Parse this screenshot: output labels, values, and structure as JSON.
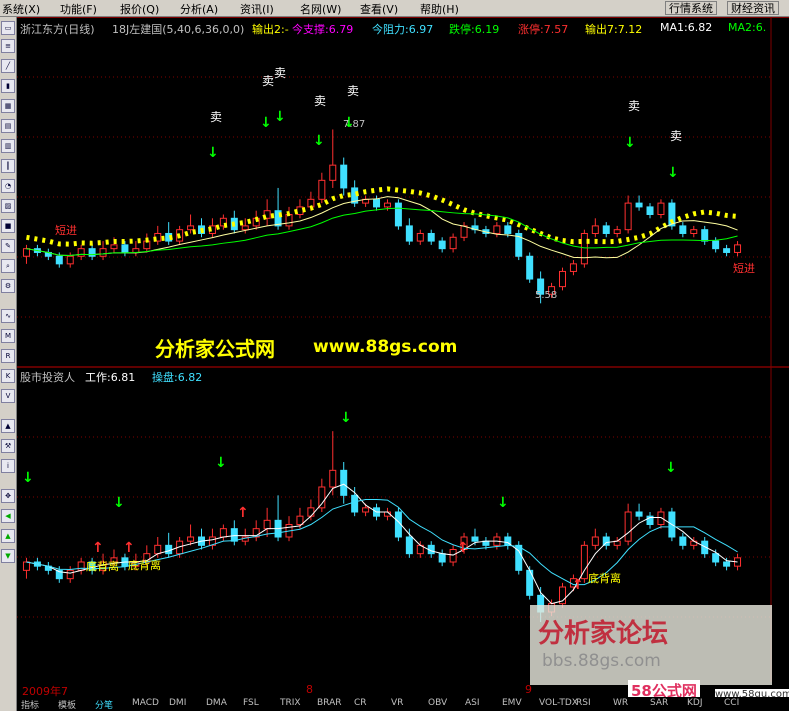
{
  "menu": {
    "items": [
      "系统(X)",
      "功能(F)",
      "报价(Q)",
      "分析(A)",
      "资讯(I)",
      "名网(W)",
      "查看(V)",
      "帮助(H)"
    ],
    "right_buttons": [
      "行情系统",
      "财经资讯"
    ]
  },
  "upper_panel": {
    "title": "浙江东方(日线)",
    "indicator": "18J左建国(5,40,6,36,0,0)",
    "out2": "输出2:-",
    "support": "今支撑:6.79",
    "resistance": "今阻力:6.97",
    "fall_stop": "跌停:6.19",
    "rise_stop": "涨停:7.57",
    "out3": "输出7:7.12",
    "ma1": "MA1:6.82",
    "ma2": "MA2:6.",
    "sell": "卖",
    "short_in": "短进",
    "high_label": "7.87",
    "low_label": "5.58",
    "watermark": "分析家公式网",
    "watermark_url": "www.88gs.com"
  },
  "lower_panel": {
    "title": "股市投资人",
    "work": "工作:6.81",
    "operate": "操盘:6.82",
    "bottom_divergence": "底背离"
  },
  "axis": {
    "year_label": "2009年7",
    "month_8": "8",
    "month_9": "9"
  },
  "tabs": [
    "指标",
    "模板",
    "分笔",
    "MACD",
    "DMI",
    "DMA",
    "FSL",
    "TRIX",
    "BRAR",
    "CR",
    "VR",
    "OBV",
    "ASI",
    "EMV",
    "VOL-TDX",
    "RSI",
    "WR",
    "SAR",
    "KDJ",
    "CCI"
  ],
  "watermarks": {
    "forum": "分析家论坛",
    "forum_url": "bbs.88gs.com",
    "gs58": "58公式网",
    "gs58_url": "www.58gu.com"
  },
  "colors": {
    "up": "#ff3030",
    "down": "#40e0ff",
    "yellow": "#ffff00",
    "green": "#00ff00",
    "magenta": "#ff00ff",
    "grid_red": "#800000"
  },
  "chart_data": {
    "type": "candlestick",
    "series": [
      {
        "name": "OHLC",
        "values": [
          [
            6.2,
            6.3,
            6.1,
            6.35
          ],
          [
            6.3,
            6.25,
            6.2,
            6.35
          ],
          [
            6.25,
            6.2,
            6.15,
            6.3
          ],
          [
            6.2,
            6.1,
            6.05,
            6.25
          ],
          [
            6.1,
            6.2,
            6.05,
            6.25
          ],
          [
            6.2,
            6.3,
            6.15,
            6.35
          ],
          [
            6.3,
            6.2,
            6.15,
            6.35
          ],
          [
            6.2,
            6.3,
            6.15,
            6.4
          ],
          [
            6.3,
            6.35,
            6.25,
            6.45
          ],
          [
            6.35,
            6.25,
            6.2,
            6.4
          ],
          [
            6.25,
            6.3,
            6.2,
            6.4
          ],
          [
            6.3,
            6.4,
            6.25,
            6.5
          ],
          [
            6.4,
            6.5,
            6.35,
            6.6
          ],
          [
            6.5,
            6.4,
            6.35,
            6.65
          ],
          [
            6.4,
            6.55,
            6.35,
            6.6
          ],
          [
            6.55,
            6.6,
            6.5,
            6.75
          ],
          [
            6.6,
            6.5,
            6.45,
            6.7
          ],
          [
            6.5,
            6.6,
            6.45,
            6.7
          ],
          [
            6.6,
            6.7,
            6.55,
            6.75
          ],
          [
            6.7,
            6.55,
            6.5,
            6.8
          ],
          [
            6.55,
            6.6,
            6.5,
            6.7
          ],
          [
            6.6,
            6.7,
            6.55,
            6.8
          ],
          [
            6.7,
            6.8,
            6.6,
            6.95
          ],
          [
            6.8,
            6.6,
            6.55,
            7.1
          ],
          [
            6.6,
            6.75,
            6.55,
            6.85
          ],
          [
            6.75,
            6.85,
            6.7,
            6.95
          ],
          [
            6.85,
            6.95,
            6.8,
            7.05
          ],
          [
            6.95,
            7.2,
            6.9,
            7.3
          ],
          [
            7.2,
            7.4,
            7.1,
            7.87
          ],
          [
            7.4,
            7.1,
            7.0,
            7.5
          ],
          [
            7.1,
            6.9,
            6.85,
            7.2
          ],
          [
            6.9,
            6.95,
            6.85,
            7.0
          ],
          [
            6.95,
            6.85,
            6.8,
            7.0
          ],
          [
            6.85,
            6.9,
            6.8,
            6.95
          ],
          [
            6.9,
            6.6,
            6.55,
            6.95
          ],
          [
            6.6,
            6.4,
            6.35,
            6.7
          ],
          [
            6.4,
            6.5,
            6.35,
            6.55
          ],
          [
            6.5,
            6.4,
            6.35,
            6.55
          ],
          [
            6.4,
            6.3,
            6.25,
            6.45
          ],
          [
            6.3,
            6.45,
            6.25,
            6.5
          ],
          [
            6.45,
            6.6,
            6.4,
            6.65
          ],
          [
            6.6,
            6.55,
            6.5,
            6.7
          ],
          [
            6.55,
            6.5,
            6.45,
            6.6
          ],
          [
            6.5,
            6.6,
            6.45,
            6.65
          ],
          [
            6.6,
            6.5,
            6.45,
            6.65
          ],
          [
            6.5,
            6.2,
            6.15,
            6.55
          ],
          [
            6.2,
            5.9,
            5.85,
            6.25
          ],
          [
            5.9,
            5.7,
            5.58,
            6.0
          ],
          [
            5.7,
            5.8,
            5.65,
            5.85
          ],
          [
            5.8,
            6.0,
            5.75,
            6.05
          ],
          [
            6.0,
            6.1,
            5.95,
            6.15
          ],
          [
            6.1,
            6.5,
            6.05,
            6.55
          ],
          [
            6.5,
            6.6,
            6.45,
            6.7
          ],
          [
            6.6,
            6.5,
            6.45,
            6.65
          ],
          [
            6.5,
            6.55,
            6.45,
            6.6
          ],
          [
            6.55,
            6.9,
            6.5,
            7.0
          ],
          [
            6.9,
            6.85,
            6.8,
            7.0
          ],
          [
            6.85,
            6.75,
            6.7,
            6.9
          ],
          [
            6.75,
            6.9,
            6.7,
            6.95
          ],
          [
            6.9,
            6.6,
            6.55,
            6.95
          ],
          [
            6.6,
            6.5,
            6.45,
            6.65
          ],
          [
            6.5,
            6.55,
            6.45,
            6.6
          ],
          [
            6.55,
            6.4,
            6.35,
            6.6
          ],
          [
            6.4,
            6.3,
            6.25,
            6.45
          ],
          [
            6.3,
            6.25,
            6.2,
            6.35
          ],
          [
            6.25,
            6.35,
            6.2,
            6.4
          ]
        ]
      }
    ],
    "ylim": [
      5.4,
      8.1
    ]
  }
}
